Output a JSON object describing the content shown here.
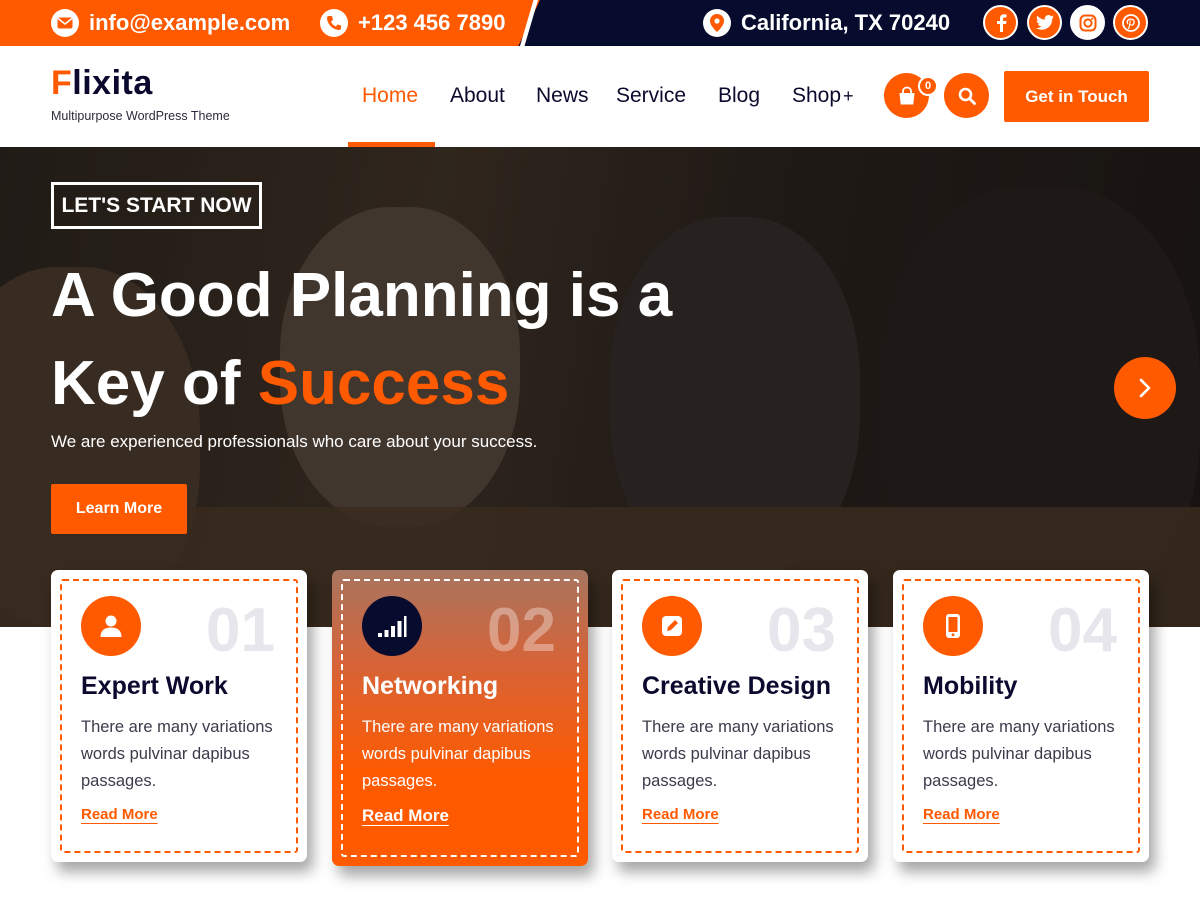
{
  "topbar": {
    "email": "info@example.com",
    "phone": "+123 456 7890",
    "location": "California, TX 70240",
    "social": [
      "facebook-icon",
      "twitter-icon",
      "instagram-icon",
      "pinterest-icon"
    ]
  },
  "header": {
    "logo_first": "F",
    "logo_rest": "lixita",
    "tagline": "Multipurpose WordPress Theme",
    "nav": [
      "Home",
      "About",
      "News",
      "Service",
      "Blog",
      "Shop"
    ],
    "shop_suffix": "+",
    "active_nav": "Home",
    "cart_count": "0",
    "cta_label": "Get in Touch"
  },
  "hero": {
    "badge": "LET'S START NOW",
    "title_line1": "A Good Planning is a",
    "title_line2_prefix": "Key of",
    "title_line2_accent": "Success",
    "subtitle": "We are experienced professionals who care about your success.",
    "button": "Learn More"
  },
  "cards": [
    {
      "number": "01",
      "title": "Expert Work",
      "text": "There are many variations words pulvinar dapibus passages.",
      "link": "Read More",
      "icon": "user-icon"
    },
    {
      "number": "02",
      "title": "Networking",
      "text": "There are many variations words pulvinar dapibus passages.",
      "link": "Read More",
      "icon": "signal-bars-icon"
    },
    {
      "number": "03",
      "title": "Creative Design",
      "text": "There are many variations words pulvinar dapibus passages.",
      "link": "Read More",
      "icon": "edit-icon"
    },
    {
      "number": "04",
      "title": "Mobility",
      "text": "There are many variations words pulvinar dapibus passages.",
      "link": "Read More",
      "icon": "mobile-icon"
    }
  ],
  "colors": {
    "accent": "#ff5a00",
    "dark": "#070b2e",
    "white": "#ffffff"
  }
}
